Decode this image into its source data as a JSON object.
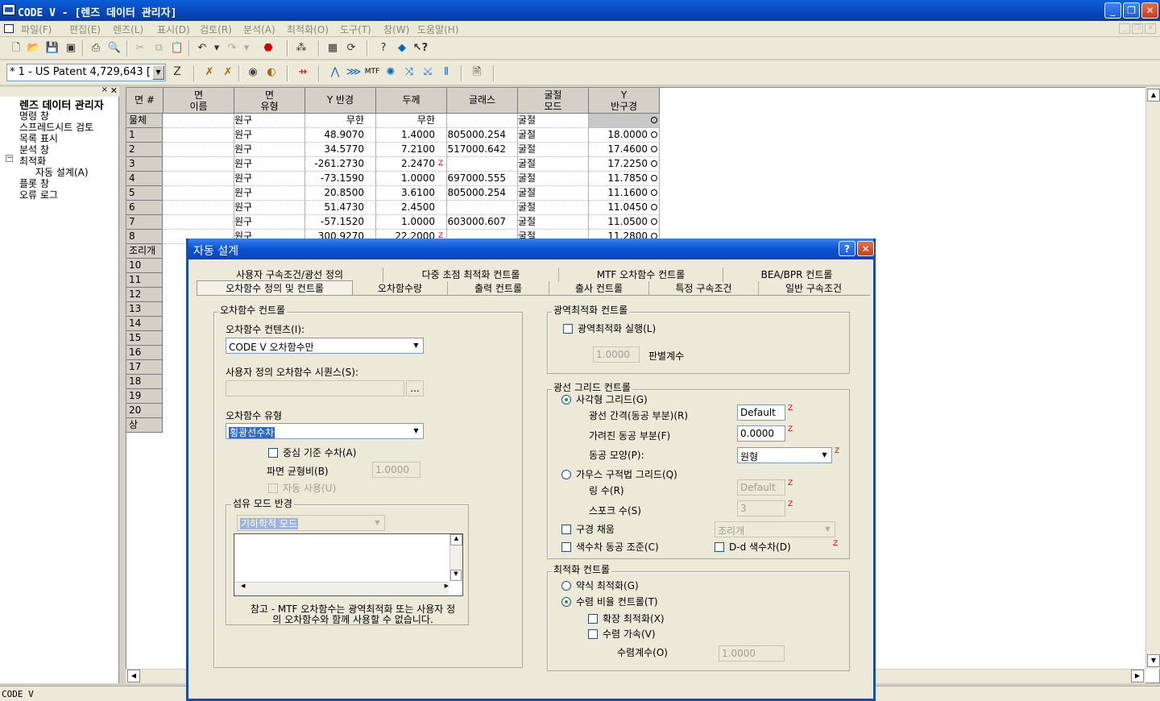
{
  "window": {
    "title": "CODE V - [렌즈 데이터 관리자]",
    "min": "_",
    "restore": "❐",
    "close": "✕"
  },
  "menu": [
    "파일(F)",
    "편집(E)",
    "렌즈(L)",
    "표시(D)",
    "검토(R)",
    "분석(A)",
    "최적화(O)",
    "도구(T)",
    "창(W)",
    "도움말(H)"
  ],
  "toolbar": {
    "lens_combo": "* 1 - US Patent 4,729,643 [",
    "z_label": "Z"
  },
  "tree": {
    "root": "렌즈 데이터 관리자",
    "items": [
      "명령 창",
      "스프레드시트 검토",
      "목록 표시",
      "분석 창",
      "최적화",
      "자동 설계(A)",
      "플롯 창",
      "오류 로그"
    ],
    "expander": "−"
  },
  "grid": {
    "headers": [
      "면 #",
      "면\n이름",
      "면\n유형",
      "Y 반경",
      "두께",
      "글래스",
      "굴절\n모드",
      "Y\n반구경"
    ],
    "rows": [
      {
        "n": "물체",
        "type": "원구",
        "r": "무한",
        "t": "무한",
        "g": "",
        "mode": "굴절",
        "sa": ""
      },
      {
        "n": "1",
        "type": "원구",
        "r": "48.9070",
        "t": "1.4000",
        "g": "805000.254",
        "mode": "굴절",
        "sa": "18.0000"
      },
      {
        "n": "2",
        "type": "원구",
        "r": "34.5770",
        "t": "7.2100",
        "g": "517000.642",
        "mode": "굴절",
        "sa": "17.4600"
      },
      {
        "n": "3",
        "type": "원구",
        "r": "-261.2730",
        "t": "2.2470",
        "g": "",
        "mode": "굴절",
        "sa": "17.2250",
        "tz": "Z"
      },
      {
        "n": "4",
        "type": "원구",
        "r": "-73.1590",
        "t": "1.0000",
        "g": "697000.555",
        "mode": "굴절",
        "sa": "11.7850"
      },
      {
        "n": "5",
        "type": "원구",
        "r": "20.8500",
        "t": "3.6100",
        "g": "805000.254",
        "mode": "굴절",
        "sa": "11.1600"
      },
      {
        "n": "6",
        "type": "원구",
        "r": "51.4730",
        "t": "2.4500",
        "g": "",
        "mode": "굴절",
        "sa": "11.0450"
      },
      {
        "n": "7",
        "type": "원구",
        "r": "-57.1520",
        "t": "1.0000",
        "g": "603000.607",
        "mode": "굴절",
        "sa": "11.0500"
      },
      {
        "n": "8",
        "type": "원구",
        "r": "300.9270",
        "t": "22.2000",
        "g": "",
        "mode": "굴절",
        "sa": "11.2800",
        "tz": "Z"
      }
    ],
    "extra_rows": [
      "조리개",
      "10",
      "11",
      "12",
      "13",
      "14",
      "15",
      "16",
      "17",
      "18",
      "19",
      "20",
      "상"
    ]
  },
  "status": "CODE V",
  "dialog": {
    "title": "자동 설계",
    "help": "?",
    "close": "✕",
    "tabs_row1": [
      "사용자 구속조건/광선 정의",
      "다중 초점 최적화 컨트롤",
      "MTF 오차함수 컨트롤",
      "BEA/BPR 컨트롤"
    ],
    "tabs_row2": [
      "오차함수 정의 및 컨트롤",
      "오차함수량",
      "출력 컨트롤",
      "출사 컨트롤",
      "특정 구속조건",
      "일반 구속조건"
    ],
    "merit": {
      "group": "오차함수 컨트롤",
      "content_label": "오차함수 컨텐츠(I):",
      "content_value": "CODE V 오차함수만",
      "seq_label": "사용자 정의 오차함수 시퀀스(S):",
      "seq_value": "",
      "browse": "...",
      "type_label": "오차함수 유형",
      "type_value": "횡광선수차",
      "center_label": "중심 기준 수차(A)",
      "aspect_label": "파면 균형비(B)",
      "aspect_value": "1.0000",
      "auto_label": "자동 사용(U)",
      "fiber_group": "섬유 모드 반경",
      "fiber_value": "기하학적 모드",
      "note": "참고 - MTF 오차함수는 광역최적화 또는 사용자 정의 오차함수와 함께 사용할 수 없습니다."
    },
    "global": {
      "group": "광역최적화 컨트롤",
      "run_label": "광역최적화 실행(L)",
      "value": "1.0000",
      "disc_label": "판별계수"
    },
    "raygrid": {
      "group": "광선 그리드 컨트롤",
      "rect_label": "사각형 그리드(G)",
      "spacing_label": "광선 간격(동공 부분)(R)",
      "spacing_value": "Default",
      "obsc_label": "가려진 동공 부분(F)",
      "obsc_value": "0.0000",
      "shape_label": "동공 모양(P):",
      "shape_value": "원형",
      "gauss_label": "가우스 구적법 그리드(Q)",
      "rings_label": "링 수(R)",
      "rings_value": "Default",
      "spokes_label": "스포크 수(S)",
      "spokes_value": "3",
      "fill_label": "구경 채움",
      "fill_value": "조리개",
      "color_label": "색수차 동공 조준(C)",
      "dd_label": "D-d 색수차(D)",
      "z": "Z"
    },
    "opt": {
      "group": "최적화 컨트롤",
      "weak_label": "약식 최적화(G)",
      "conv_label": "수렴 비율 컨트롤(T)",
      "ext_label": "확장 최적화(X)",
      "accel_label": "수렴 가속(V)",
      "coef_label": "수렴계수(O)",
      "coef_value": "1.0000"
    }
  }
}
